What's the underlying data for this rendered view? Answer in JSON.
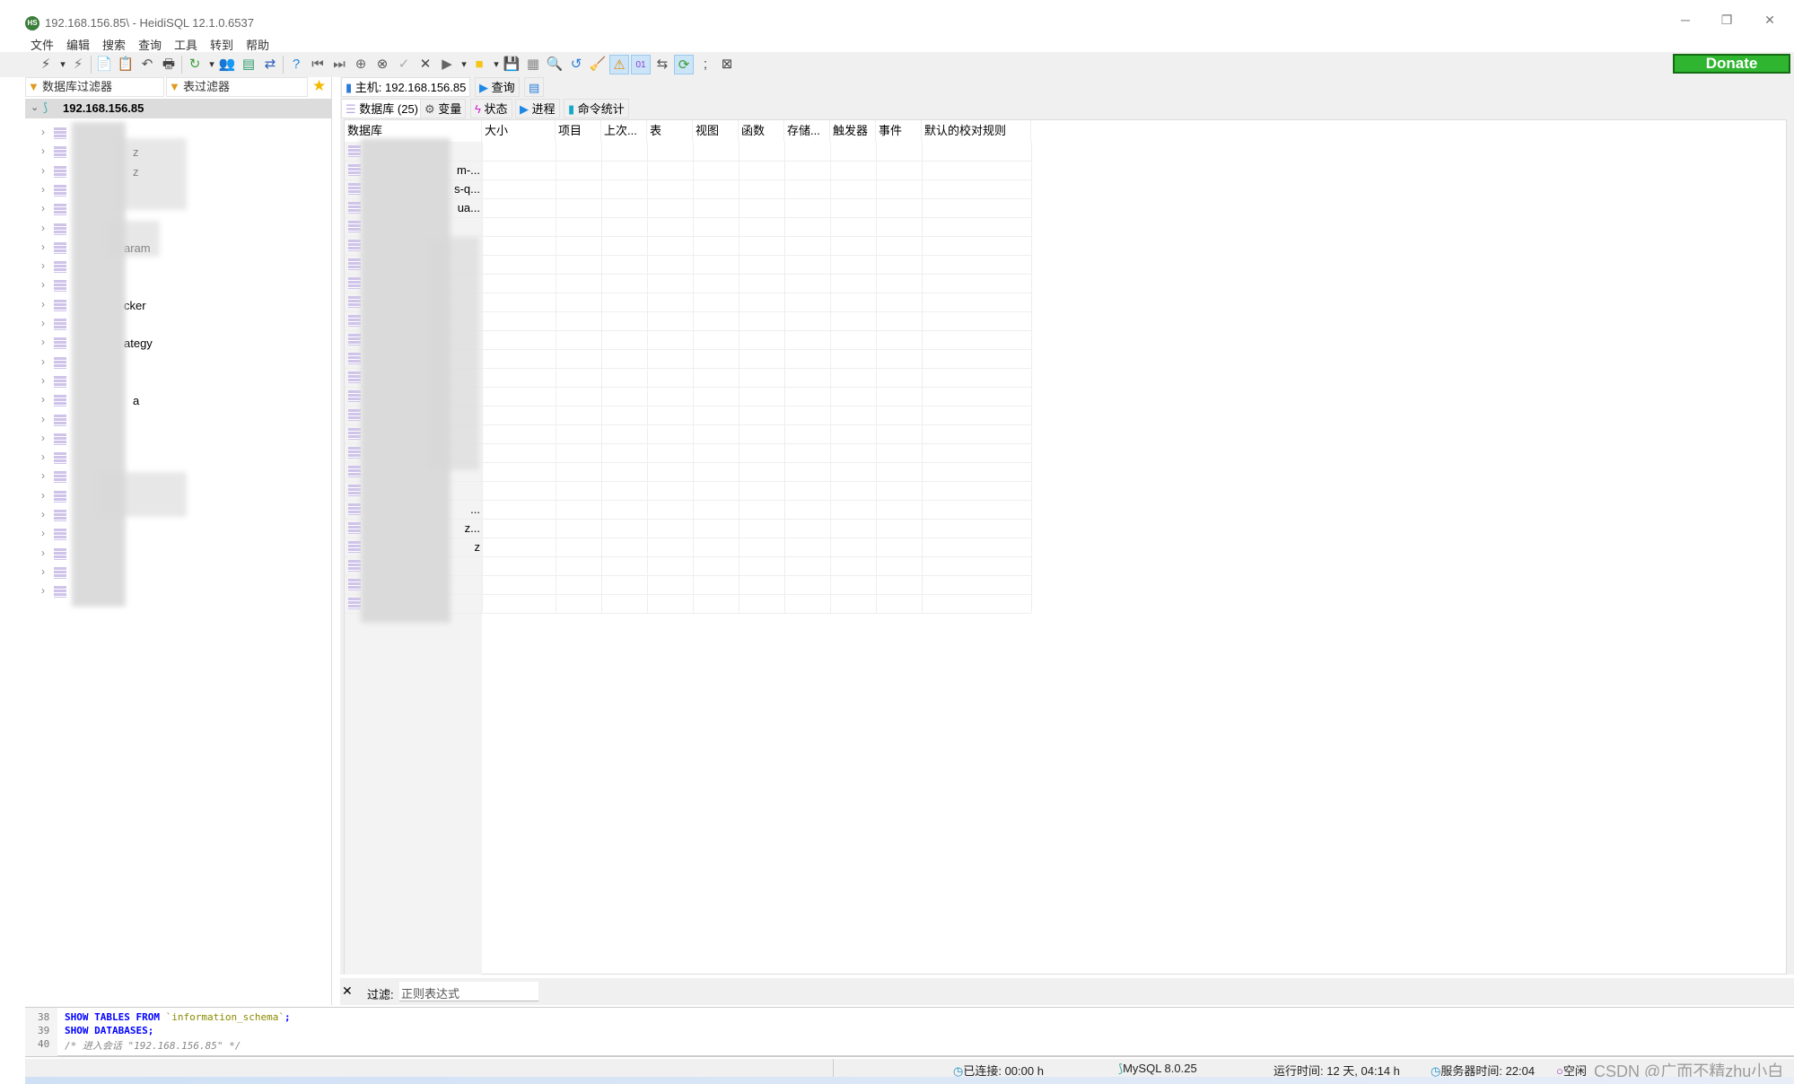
{
  "window": {
    "title": "192.168.156.85\\ - HeidiSQL 12.1.0.6537",
    "logo_text": "HS",
    "minimize": "─",
    "restore": "❐",
    "close": "✕"
  },
  "menu": [
    "文件",
    "编辑",
    "搜索",
    "查询",
    "工具",
    "转到",
    "帮助"
  ],
  "toolbar": {
    "icons": [
      {
        "name": "connect-icon",
        "glyph": "⚡",
        "color": "#555"
      },
      {
        "name": "dropdown-arrow-icon",
        "glyph": "▾",
        "color": "#333"
      },
      {
        "name": "disconnect-icon",
        "glyph": "⚡",
        "color": "#777"
      },
      {
        "name": "copy-icon",
        "glyph": "📄",
        "color": "#2a7bd8"
      },
      {
        "name": "paste-icon",
        "glyph": "📋",
        "color": "#2a7bd8"
      },
      {
        "name": "undo-icon",
        "glyph": "↶",
        "color": "#555"
      },
      {
        "name": "print-icon",
        "glyph": "🖶",
        "color": "#444"
      },
      {
        "name": "refresh-icon",
        "glyph": "↻",
        "color": "#3aa03a"
      },
      {
        "name": "dropdown-arrow-icon",
        "glyph": "▾",
        "color": "#333"
      },
      {
        "name": "user-manager-icon",
        "glyph": "👥",
        "color": "#c77"
      },
      {
        "name": "export-csv-icon",
        "glyph": "▤",
        "color": "#2a9a6a"
      },
      {
        "name": "transfer-icon",
        "glyph": "⇄",
        "color": "#2a5fb8"
      },
      {
        "name": "help-icon",
        "glyph": "?",
        "color": "#1e88e5"
      },
      {
        "name": "first-icon",
        "glyph": "⏮",
        "color": "#666"
      },
      {
        "name": "last-icon",
        "glyph": "⏭",
        "color": "#666"
      },
      {
        "name": "add-icon",
        "glyph": "⊕",
        "color": "#666"
      },
      {
        "name": "delete-icon",
        "glyph": "⊗",
        "color": "#555"
      },
      {
        "name": "check-icon",
        "glyph": "✓",
        "color": "#aaa"
      },
      {
        "name": "cancel-icon",
        "glyph": "✕",
        "color": "#444"
      },
      {
        "name": "run-icon",
        "glyph": "▶",
        "color": "#666"
      },
      {
        "name": "dropdown-arrow-icon",
        "glyph": "▾",
        "color": "#333"
      },
      {
        "name": "folder-icon",
        "glyph": "■",
        "color": "#f5c518"
      },
      {
        "name": "dropdown-arrow-icon",
        "glyph": "▾",
        "color": "#333"
      },
      {
        "name": "save-icon",
        "glyph": "💾",
        "color": "#555"
      },
      {
        "name": "save-as-icon",
        "glyph": "▦",
        "color": "#888"
      },
      {
        "name": "search-icon",
        "glyph": "🔍",
        "color": "#2a7bd8"
      },
      {
        "name": "replace-icon",
        "glyph": "↺",
        "color": "#2a7bd8"
      },
      {
        "name": "clean-icon",
        "glyph": "🧹",
        "color": "#e0a020"
      },
      {
        "name": "warning-icon",
        "glyph": "⚠",
        "color": "#e08a00"
      },
      {
        "name": "binary-icon",
        "glyph": "01",
        "color": "#8a3ad8"
      },
      {
        "name": "wrap-icon",
        "glyph": "⇆",
        "color": "#555"
      },
      {
        "name": "sync-icon",
        "glyph": "⟳",
        "color": "#3aa03a"
      },
      {
        "name": "semicolon-icon",
        "glyph": ";",
        "color": "#444"
      },
      {
        "name": "close-tab-icon",
        "glyph": "⊠",
        "color": "#444"
      }
    ],
    "donate_label": "Donate"
  },
  "left": {
    "db_filter": "数据库过滤器",
    "table_filter": "表过滤器",
    "root": "192.168.156.85",
    "tree_items": [
      "",
      "z",
      "z",
      "",
      "",
      "",
      "aram",
      "",
      "",
      "cker",
      "",
      "ategy",
      "",
      "",
      "a",
      "",
      "",
      "",
      "",
      "",
      "",
      "",
      "",
      "",
      ""
    ]
  },
  "tabs": {
    "host": "主机: 192.168.156.85",
    "query": "查询",
    "sub": [
      {
        "label": "数据库 (25)",
        "icon": "database-icon"
      },
      {
        "label": "变量",
        "icon": "gear-icon"
      },
      {
        "label": "状态",
        "icon": "lightning-icon"
      },
      {
        "label": "进程",
        "icon": "play-icon"
      },
      {
        "label": "命令统计",
        "icon": "bar-chart-icon"
      }
    ]
  },
  "grid": {
    "columns": [
      "数据库",
      "大小",
      "项目",
      "上次...",
      "表",
      "视图",
      "函数",
      "存储...",
      "触发器",
      "事件",
      "默认的校对规则"
    ],
    "rows": [
      "",
      "m-...",
      "s-q...",
      "ua...",
      "",
      "",
      "",
      "",
      "",
      "",
      "",
      "",
      "",
      "",
      "",
      "",
      "",
      "",
      "",
      "...",
      "z...",
      "z",
      "",
      "",
      ""
    ]
  },
  "filterbar": {
    "close": "✕",
    "label": "过滤:",
    "placeholder": "正则表达式"
  },
  "sqllog": [
    {
      "n": "38"
    },
    {
      "n": "39",
      "text": "SHOW DATABASES;"
    },
    {
      "n": "40",
      "text": "/* 进入会话 \"192.168.156.85\" */"
    }
  ],
  "sql38": {
    "kw": "SHOW TABLES FROM",
    "str": "`information_schema`",
    "end": ";"
  },
  "status": {
    "connected": "已连接: 00:00 h",
    "version": "MySQL 8.0.25",
    "uptime": "运行时间: 12 天, 04:14 h",
    "server_time": "服务器时间: 22:04",
    "idle": "空闲",
    "watermark": "CSDN @广而不精zhu小白"
  }
}
